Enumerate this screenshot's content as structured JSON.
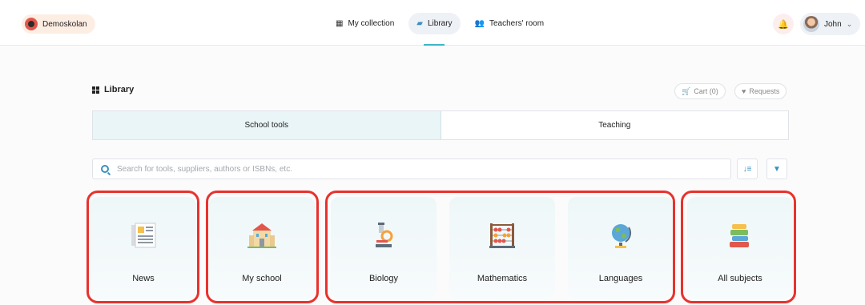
{
  "header": {
    "school_name": "Demoskolan",
    "nav": [
      {
        "label": "My collection",
        "icon": "grid-icon"
      },
      {
        "label": "Library",
        "icon": "book-icon",
        "active": true
      },
      {
        "label": "Teachers' room",
        "icon": "people-icon"
      }
    ],
    "user_name": "John"
  },
  "library": {
    "title": "Library",
    "cart_label": "Cart (0)",
    "requests_label": "Requests",
    "tabs": [
      "School tools",
      "Teaching"
    ],
    "search_placeholder": "Search for tools, suppliers, authors or ISBNs, etc."
  },
  "categories": [
    {
      "label": "News",
      "icon": "newspaper-icon"
    },
    {
      "label": "My school",
      "icon": "school-building-icon"
    },
    {
      "label": "Biology",
      "icon": "microscope-icon"
    },
    {
      "label": "Mathematics",
      "icon": "abacus-icon"
    },
    {
      "label": "Languages",
      "icon": "globe-icon"
    },
    {
      "label": "All subjects",
      "icon": "books-icon"
    }
  ],
  "colors": {
    "accent": "#3cb6c8",
    "highlight": "#e8322d",
    "link": "#3a8fc2"
  }
}
